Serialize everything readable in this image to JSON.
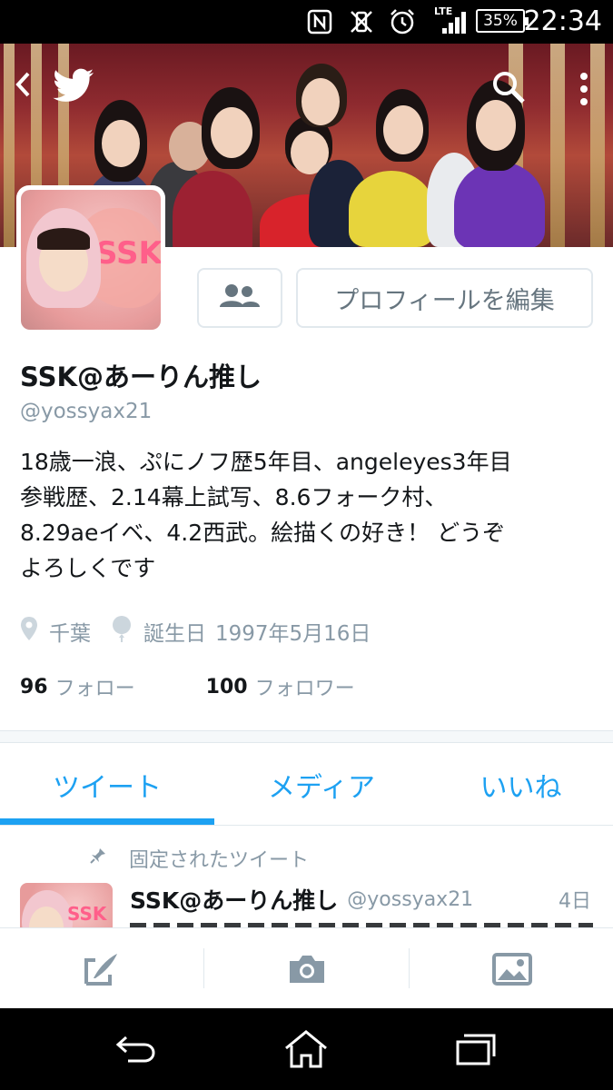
{
  "status_bar": {
    "time": "22:34",
    "battery": "35%",
    "network": "LTE",
    "icons": [
      "nfc-icon",
      "vibrate-off-icon",
      "alarm-icon",
      "signal-icon",
      "battery-icon"
    ]
  },
  "header": {
    "back_icon": "back-arrow-icon",
    "logo_icon": "twitter-bird-icon",
    "search_icon": "search-icon",
    "overflow_icon": "more-vert-icon"
  },
  "avatar": {
    "badge_text": "SSK"
  },
  "actions": {
    "follow_icon": "people-icon",
    "edit_profile_label": "プロフィールを編集"
  },
  "profile": {
    "name": "SSK@あーりん推し",
    "handle": "@yossyax21",
    "bio_lines": [
      "18歳一浪、ぷにノフ歴5年目、angeleyes3年目",
      "参戦歴、2.14幕上試写、8.6フォーク村、",
      "8.29aeイベ、4.2西武。絵描くの好き！ どうぞ",
      "よろしくです"
    ],
    "location": "千葉",
    "birthday_label": "誕生日",
    "birthday_value": "1997年5月16日",
    "following_count": "96",
    "following_label": "フォロー",
    "followers_count": "100",
    "followers_label": "フォロワー"
  },
  "tabs": [
    {
      "label": "ツイート",
      "active": true
    },
    {
      "label": "メディア",
      "active": false
    },
    {
      "label": "いいね",
      "active": false
    }
  ],
  "pinned_tweet": {
    "pinned_label": "固定されたツイート",
    "author_name": "SSK@あーりん推し",
    "author_handle": "@yossyax21",
    "time": "4日",
    "avatar_badge": "SSK"
  },
  "compose_bar": {
    "icons": [
      "compose-tweet-icon",
      "camera-icon",
      "gallery-icon"
    ]
  },
  "nav_bar": {
    "icons": [
      "back-nav-icon",
      "home-nav-icon",
      "recents-nav-icon"
    ]
  },
  "colors": {
    "accent": "#1da1f2",
    "muted": "#8899a6",
    "text": "#14171a",
    "border": "#e1e8ed"
  }
}
